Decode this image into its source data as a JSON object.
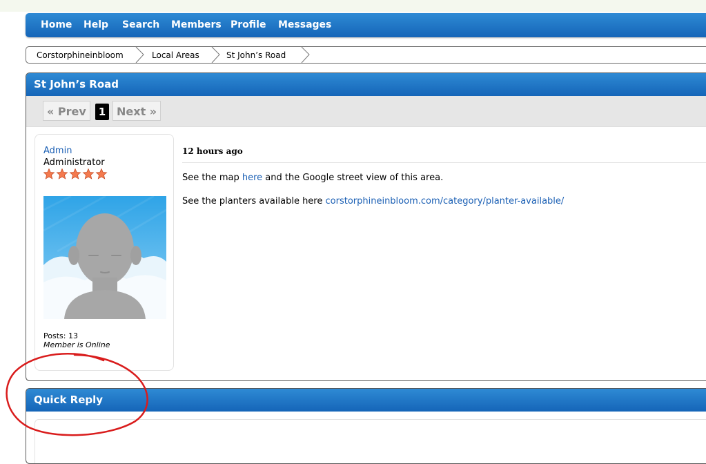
{
  "nav": {
    "items": [
      "Home",
      "Help",
      "Search",
      "Members",
      "Profile",
      "Messages"
    ]
  },
  "breadcrumb": [
    "Corstorphineinbloom",
    "Local Areas",
    "St John’s Road"
  ],
  "thread": {
    "title": "St John’s Road",
    "pager": {
      "prev": "« Prev",
      "current": "1",
      "next": "Next »"
    }
  },
  "post": {
    "username": "Admin",
    "role": "Administrator",
    "stars": 5,
    "posts": "Posts: 13",
    "status": "Member is Online",
    "time": "12 hours ago",
    "line1_a": "See the map ",
    "line1_link": "here",
    "line1_b": " and the Google street view of this area.",
    "line2_a": "See the planters available here ",
    "line2_link": "corstorphineinbloom.com/category/planter-available/"
  },
  "quick_reply": {
    "title": "Quick Reply"
  },
  "colors": {
    "header_blue": "#1a6fc4",
    "link_blue": "#1a5fb4",
    "annotation_red": "#d91c1c",
    "star_orange": "#f47a4e"
  },
  "icons": [
    "star-icon",
    "chevron-separator-icon",
    "default-avatar"
  ]
}
